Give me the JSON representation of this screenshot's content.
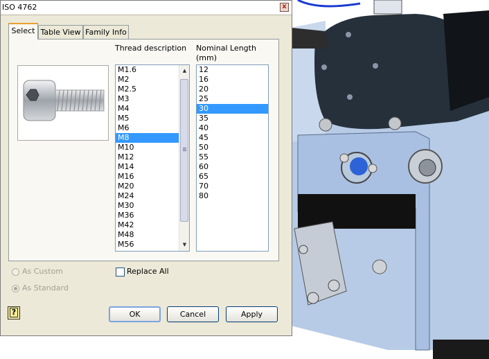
{
  "dialog": {
    "title": "ISO 4762",
    "close_glyph": "x"
  },
  "tabs": [
    {
      "label": "Select",
      "active": true
    },
    {
      "label": "Table View",
      "active": false
    },
    {
      "label": "Family Info",
      "active": false
    }
  ],
  "thread": {
    "header": "Thread description",
    "items": [
      "M1.6",
      "M2",
      "M2.5",
      "M3",
      "M4",
      "M5",
      "M6",
      "M8",
      "M10",
      "M12",
      "M14",
      "M16",
      "M20",
      "M24",
      "M30",
      "M36",
      "M42",
      "M48",
      "M56"
    ],
    "selected": "M8"
  },
  "length": {
    "header_line1": "Nominal Length",
    "header_line2": "(mm)",
    "items": [
      "12",
      "16",
      "20",
      "25",
      "30",
      "35",
      "40",
      "45",
      "50",
      "55",
      "60",
      "65",
      "70",
      "80"
    ],
    "selected": "30"
  },
  "options": {
    "as_custom": "As Custom",
    "as_standard": "As Standard",
    "replace_all": "Replace All"
  },
  "buttons": {
    "ok": "OK",
    "cancel": "Cancel",
    "apply": "Apply",
    "help": "?"
  },
  "icons": {
    "preview": "socket-head-cap-screw-image",
    "help": "help-icon",
    "close": "close-icon"
  },
  "colors": {
    "selection": "#3399ff",
    "model_blue": "#8fb3dd",
    "model_dark": "#2a3440"
  }
}
